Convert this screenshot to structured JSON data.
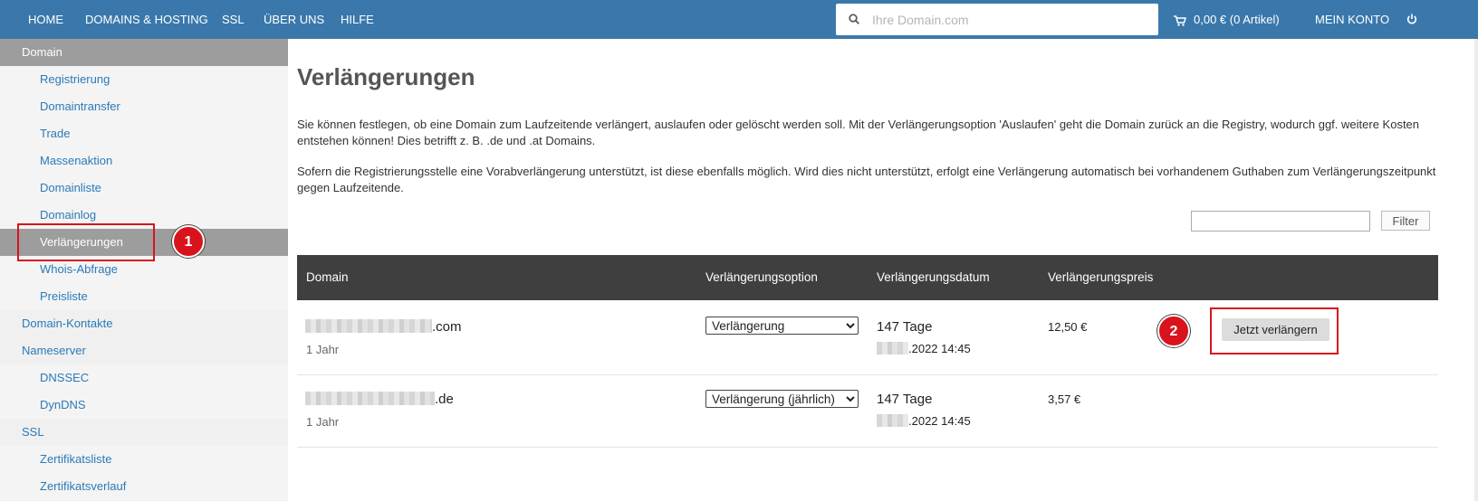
{
  "nav": {
    "items": [
      "HOME",
      "DOMAINS & HOSTING",
      "SSL",
      "ÜBER UNS",
      "HILFE"
    ],
    "search_placeholder": "Ihre Domain.com",
    "cart": "0,00 € (0 Artikel)",
    "account": "MEIN KONTO"
  },
  "sidebar": {
    "items": [
      {
        "label": "Domain",
        "kind": "section"
      },
      {
        "label": "Registrierung",
        "kind": "sub"
      },
      {
        "label": "Domaintransfer",
        "kind": "sub"
      },
      {
        "label": "Trade",
        "kind": "sub"
      },
      {
        "label": "Massenaktion",
        "kind": "sub"
      },
      {
        "label": "Domainliste",
        "kind": "sub"
      },
      {
        "label": "Domainlog",
        "kind": "sub"
      },
      {
        "label": "Verlängerungen",
        "kind": "active"
      },
      {
        "label": "Whois-Abfrage",
        "kind": "sub"
      },
      {
        "label": "Preisliste",
        "kind": "sub"
      },
      {
        "label": "Domain-Kontakte",
        "kind": "top"
      },
      {
        "label": "Nameserver",
        "kind": "top"
      },
      {
        "label": "DNSSEC",
        "kind": "sub"
      },
      {
        "label": "DynDNS",
        "kind": "sub"
      },
      {
        "label": "SSL",
        "kind": "top"
      },
      {
        "label": "Zertifikatsliste",
        "kind": "sub"
      },
      {
        "label": "Zertifikatsverlauf",
        "kind": "sub"
      }
    ]
  },
  "annotations": [
    "1",
    "2"
  ],
  "main": {
    "title": "Verlängerungen",
    "para1": "Sie können festlegen, ob eine Domain zum Laufzeitende verlängert, auslaufen oder gelöscht werden soll. Mit der Verlängerungsoption 'Auslaufen' geht die Domain zurück an die Registry, wodurch ggf. weitere Kosten entstehen können! Dies betrifft z. B. .de und .at Domains.",
    "para2": "Sofern die Registrierungsstelle eine Vorabverlängerung unterstützt, ist diese ebenfalls möglich. Wird dies nicht unterstützt, erfolgt eine Verlängerung automatisch bei vorhandenem Guthaben zum Verlängerungszeitpunkt gegen Laufzeitende.",
    "filter_button": "Filter",
    "filter_value": "",
    "table": {
      "headers": [
        "Domain",
        "Verlängerungsoption",
        "Verlängerungsdatum",
        "Verlängerungspreis"
      ],
      "rows": [
        {
          "domain_suffix": ".com",
          "term": "1 Jahr",
          "option": "Verlängerung",
          "days": "147 Tage",
          "date": ".2022 14:45",
          "price": "12,50 €",
          "action": "Jetzt verlängern"
        },
        {
          "domain_suffix": ".de",
          "term": "1 Jahr",
          "option": "Verlängerung (jährlich)",
          "days": "147 Tage",
          "date": ".2022 14:45",
          "price": "3,57 €",
          "action": ""
        }
      ]
    }
  },
  "colors": {
    "topbar": "#3a78ab",
    "link": "#2a7ab8",
    "active": "#9d9d9d",
    "annotation": "#d9131c",
    "table_header": "#3f3f3f"
  }
}
